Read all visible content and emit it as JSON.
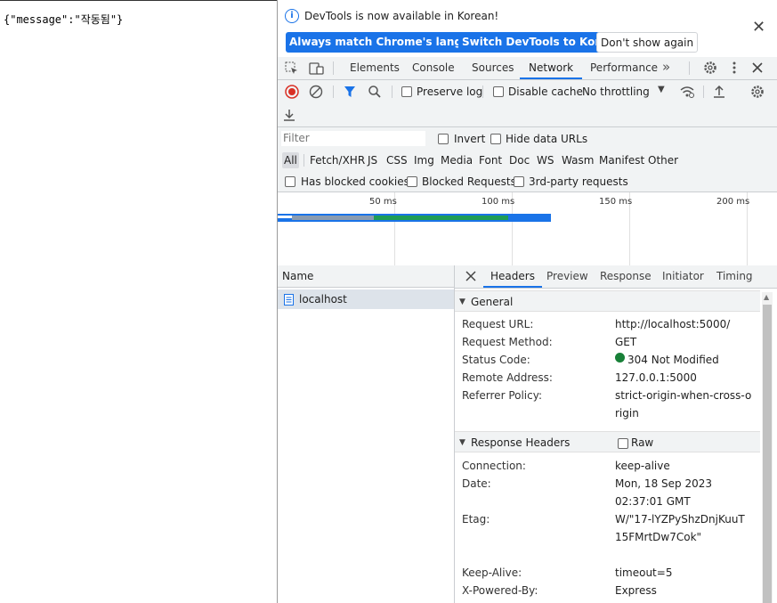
{
  "page": {
    "json_text": "{\"message\":\"작동됨\"}"
  },
  "infobar": {
    "message": "DevTools is now available in Korean!",
    "buttons": [
      "Always match Chrome's language",
      "Switch DevTools to Korean",
      "Don't show again"
    ],
    "close": "✕"
  },
  "tabs": [
    "Elements",
    "Console",
    "Sources",
    "Network",
    "Performance"
  ],
  "active_tab": "Network",
  "network_toolbar": {
    "preserve_log": "Preserve log",
    "disable_cache": "Disable cache",
    "throttling": "No throttling"
  },
  "filter_bar": {
    "placeholder": "Filter",
    "invert": "Invert",
    "hide_data_urls": "Hide data URLs",
    "types": [
      "All",
      "Fetch/XHR",
      "JS",
      "CSS",
      "Img",
      "Media",
      "Font",
      "Doc",
      "WS",
      "Wasm",
      "Manifest",
      "Other"
    ],
    "active_type": "All",
    "has_blocked_cookies": "Has blocked cookies",
    "blocked_requests": "Blocked Requests",
    "third_party": "3rd-party requests"
  },
  "overview": {
    "ticks": [
      "50 ms",
      "100 ms",
      "150 ms",
      "200 ms"
    ]
  },
  "requests": {
    "header": "Name",
    "items": [
      {
        "name": "localhost"
      }
    ]
  },
  "detail": {
    "tabs": [
      "Headers",
      "Preview",
      "Response",
      "Initiator",
      "Timing"
    ],
    "active_tab": "Headers",
    "general": {
      "title": "General",
      "rows": [
        {
          "key": "Request URL:",
          "value": "http://localhost:5000/"
        },
        {
          "key": "Request Method:",
          "value": "GET"
        },
        {
          "key": "Status Code:",
          "value": "304 Not Modified"
        },
        {
          "key": "Remote Address:",
          "value": "127.0.0.1:5000"
        },
        {
          "key": "Referrer Policy:",
          "value": "strict-origin-when-cross-origin"
        }
      ]
    },
    "response_headers": {
      "title": "Response Headers",
      "raw": "Raw",
      "rows": [
        {
          "key": "Connection:",
          "value": "keep-alive"
        },
        {
          "key": "Date:",
          "value": "Mon, 18 Sep 2023 02:37:01 GMT"
        },
        {
          "key": "Etag:",
          "value": "W/\"17-lYZPyShzDnjKuuT15FMrtDw7Cok\""
        },
        {
          "key": "Keep-Alive:",
          "value": "timeout=5"
        },
        {
          "key": "X-Powered-By:",
          "value": "Express"
        }
      ]
    }
  },
  "colors": {
    "accent": "#1a73e8",
    "status_ok": "#188038",
    "record": "#d93025"
  }
}
